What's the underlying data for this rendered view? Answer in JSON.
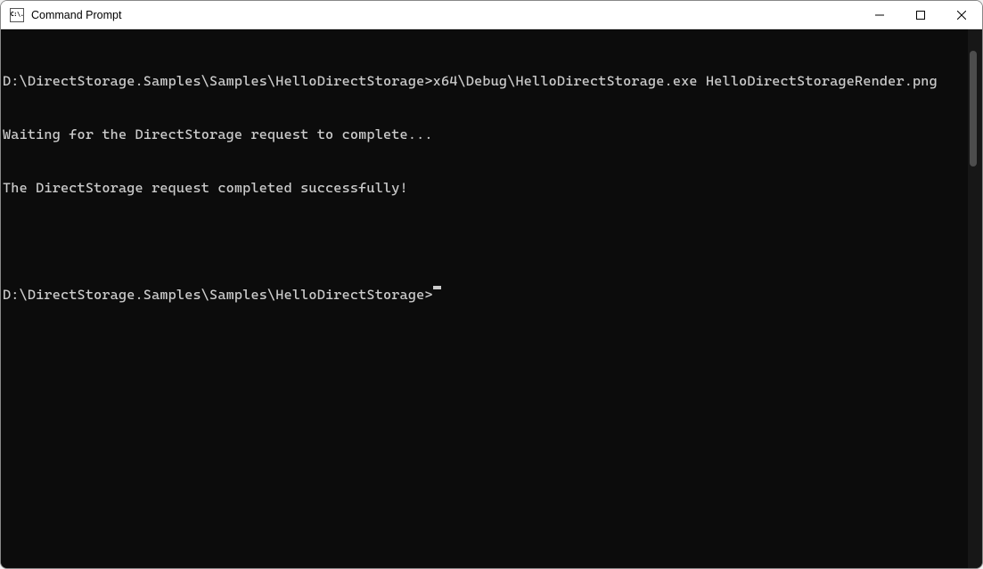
{
  "window": {
    "title": "Command Prompt",
    "icon_text": "C:\\."
  },
  "terminal": {
    "lines": [
      "D:\\DirectStorage.Samples\\Samples\\HelloDirectStorage>x64\\Debug\\HelloDirectStorage.exe HelloDirectStorageRender.png",
      "Waiting for the DirectStorage request to complete...",
      "The DirectStorage request completed successfully!",
      ""
    ],
    "current_prompt": "D:\\DirectStorage.Samples\\Samples\\HelloDirectStorage>"
  }
}
